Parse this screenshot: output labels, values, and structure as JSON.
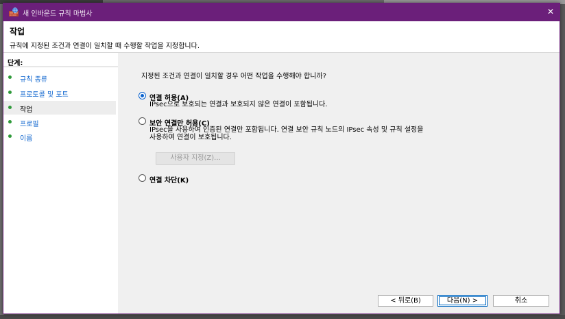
{
  "window": {
    "title": "새 인바운드 규칙 마법사",
    "close_glyph": "✕",
    "accent_color": "#6b1f7a"
  },
  "header": {
    "title": "작업",
    "description": "규칙에 지정된 조건과 연결이 일치할 때 수행할 작업을 지정합니다."
  },
  "steps": {
    "title": "단계:",
    "items": [
      {
        "label": "규칙 종류",
        "current": false
      },
      {
        "label": "프로토콜 및 포트",
        "current": false
      },
      {
        "label": "작업",
        "current": true
      },
      {
        "label": "프로필",
        "current": false
      },
      {
        "label": "이름",
        "current": false
      }
    ]
  },
  "main": {
    "question": "지정된 조건과 연결이 일치할 경우 어떤 작업을 수행해야 합니까?",
    "options": [
      {
        "label": "연결 허용(A)",
        "selected": true,
        "desc": [
          "IPsec으로 보호되는 연결과 보호되지 않은 연결이 포함됩니다."
        ]
      },
      {
        "label": "보안 연결만 허용(C)",
        "selected": false,
        "desc": [
          "IPsec을 사용하여 인증된 연결만 포함됩니다. 연결 보안 규칙 노드의 IPsec 속성 및 규칙 설정을",
          "사용하여 연결이 보호됩니다."
        ]
      },
      {
        "label": "연결 차단(K)",
        "selected": false,
        "desc": []
      }
    ],
    "custom_button": "사용자 지정(Z)..."
  },
  "footer": {
    "back": "< 뒤로(B)",
    "next": "다음(N) >",
    "cancel": "취소"
  }
}
